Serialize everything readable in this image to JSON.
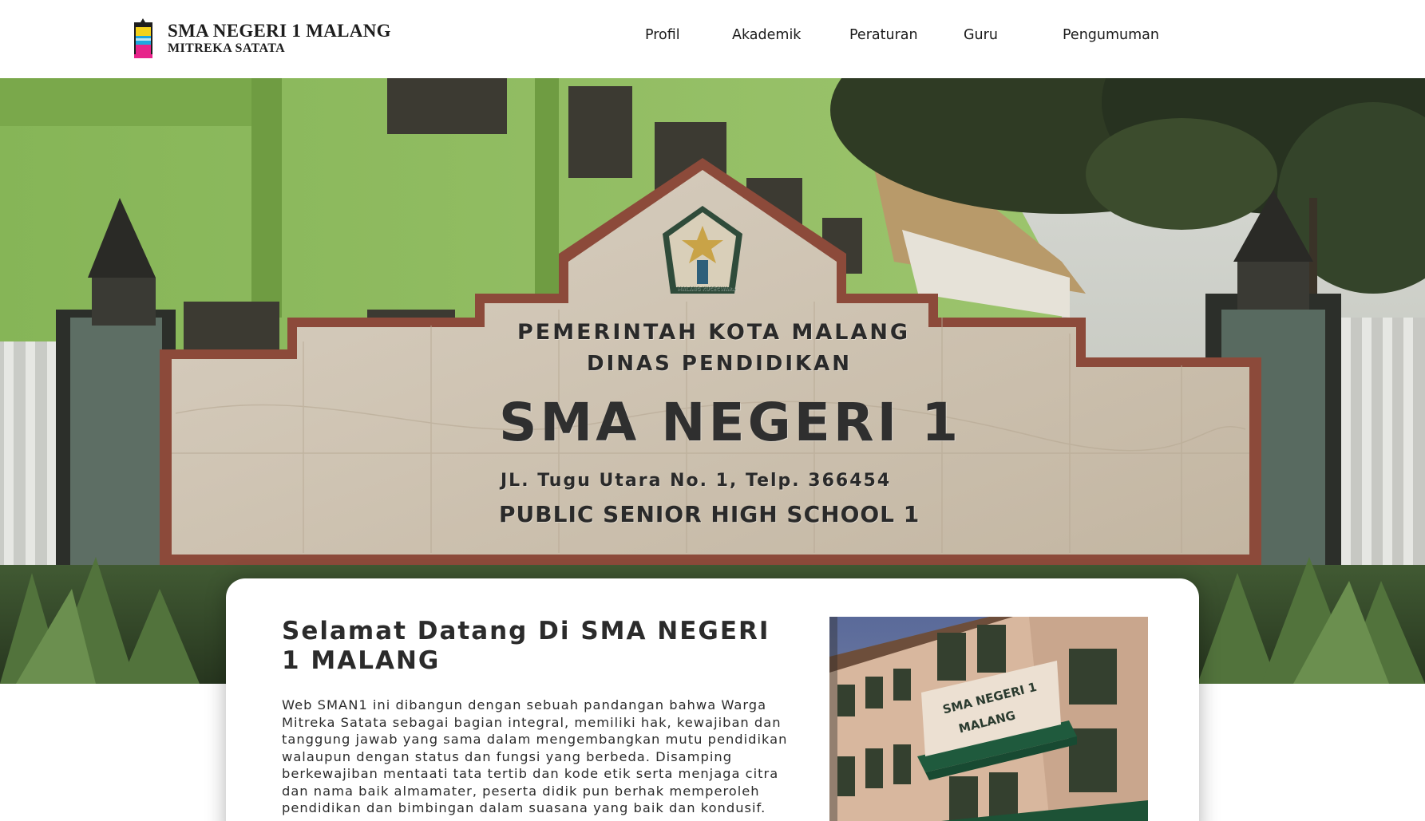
{
  "header": {
    "school_name": "SMA NEGERI 1 MALANG",
    "motto": "MITREKA SATATA",
    "logo_icon": "school-crest-icon",
    "nav": [
      {
        "label": "Profil"
      },
      {
        "label": "Akademik"
      },
      {
        "label": "Peraturan"
      },
      {
        "label": "Guru"
      },
      {
        "label": "Pengumuman"
      }
    ]
  },
  "hero": {
    "sign": {
      "line1": "PEMERINTAH  KOTA  MALANG",
      "line2": "DINAS  PENDIDIKAN",
      "line3": "SMA NEGERI 1",
      "line4": "JL. Tugu  Utara  No. 1, Telp. 366454",
      "line5": "PUBLIC SENIOR HIGH SCHOOL 1",
      "emblem_caption": "MALANG KUCECWARA"
    }
  },
  "welcome": {
    "title": "Selamat Datang Di SMA NEGERI 1 MALANG",
    "body": "Web SMAN1 ini dibangun dengan sebuah pandangan bahwa Warga Mitreka Satata sebagai bagian integral, memiliki hak, kewajiban dan tanggung jawab yang sama dalam mengembangkan mutu pendidikan walaupun dengan status dan fungsi yang berbeda. Disamping berkewajiban mentaati tata tertib dan kode etik serta menjaga citra dan nama baik almamater, peserta didik pun berhak memperoleh pendidikan dan bimbingan dalam suasana yang baik dan kondusif.",
    "photo_label_line1": "SMA NEGERI 1",
    "photo_label_line2": "MALANG"
  },
  "colors": {
    "sign_border": "#8c4a3a",
    "building_green": "#8fbf5a",
    "text_dark": "#2b2b2b"
  }
}
